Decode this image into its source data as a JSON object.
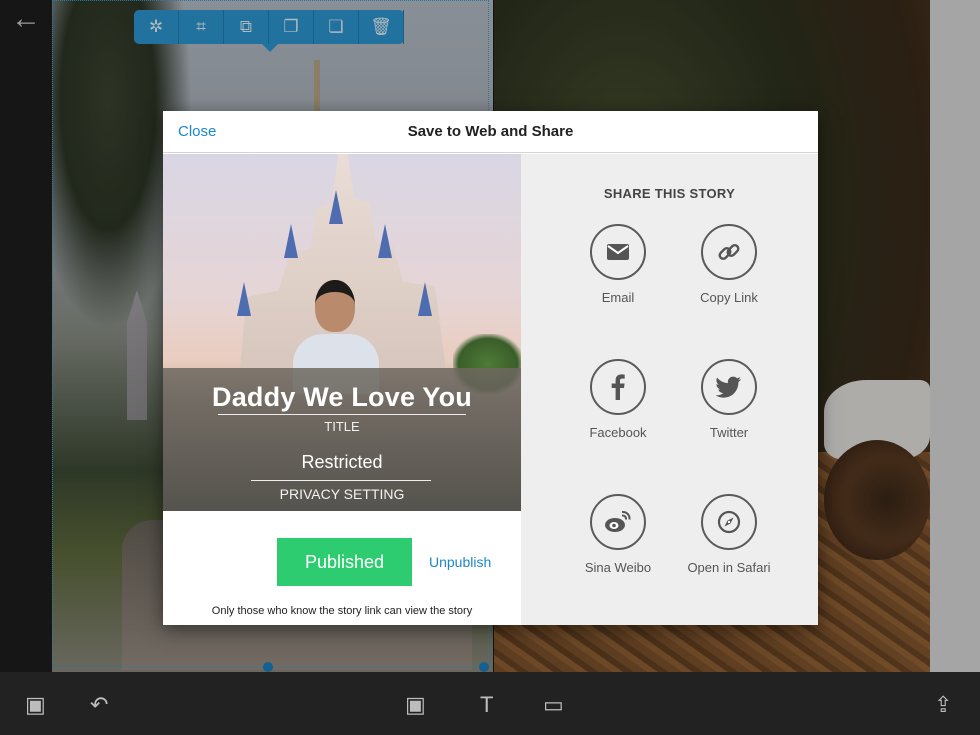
{
  "editor": {
    "back_icon": "←",
    "toolbar": [
      {
        "name": "magic-wand-icon",
        "glyph": "✲"
      },
      {
        "name": "crop-icon",
        "glyph": "⌗"
      },
      {
        "name": "replace-image-icon",
        "glyph": "⧉"
      },
      {
        "name": "bring-forward-icon",
        "glyph": "❐"
      },
      {
        "name": "send-backward-icon",
        "glyph": "❏"
      },
      {
        "name": "trash-icon",
        "glyph": "🗑"
      }
    ],
    "bottom_tools": [
      {
        "name": "photo-favorites-icon",
        "glyph": "▣"
      },
      {
        "name": "undo-icon",
        "glyph": "↶"
      },
      {
        "name": "add-photo-icon",
        "glyph": "▣"
      },
      {
        "name": "text-icon",
        "glyph": "T"
      },
      {
        "name": "page-icon",
        "glyph": "▭"
      },
      {
        "name": "share-export-icon",
        "glyph": "⇪"
      }
    ]
  },
  "modal": {
    "close_label": "Close",
    "title": "Save to Web and Share",
    "cover": {
      "story_title": "Daddy We Love You",
      "title_label": "TITLE",
      "privacy_value": "Restricted",
      "privacy_label": "PRIVACY SETTING"
    },
    "published_label": "Published",
    "unpublish_label": "Unpublish",
    "note": "Only those who know the story link can view the story",
    "share": {
      "heading": "SHARE THIS STORY",
      "items": [
        {
          "label": "Email",
          "icon": "email-icon"
        },
        {
          "label": "Copy Link",
          "icon": "link-icon"
        },
        {
          "label": "Facebook",
          "icon": "facebook-icon"
        },
        {
          "label": "Twitter",
          "icon": "twitter-icon"
        },
        {
          "label": "Sina Weibo",
          "icon": "weibo-icon"
        },
        {
          "label": "Open in Safari",
          "icon": "compass-icon"
        }
      ]
    }
  },
  "colors": {
    "accent": "#1c87c9",
    "published_green": "#2ecc71",
    "toolbar_blue": "#2c98d3"
  }
}
